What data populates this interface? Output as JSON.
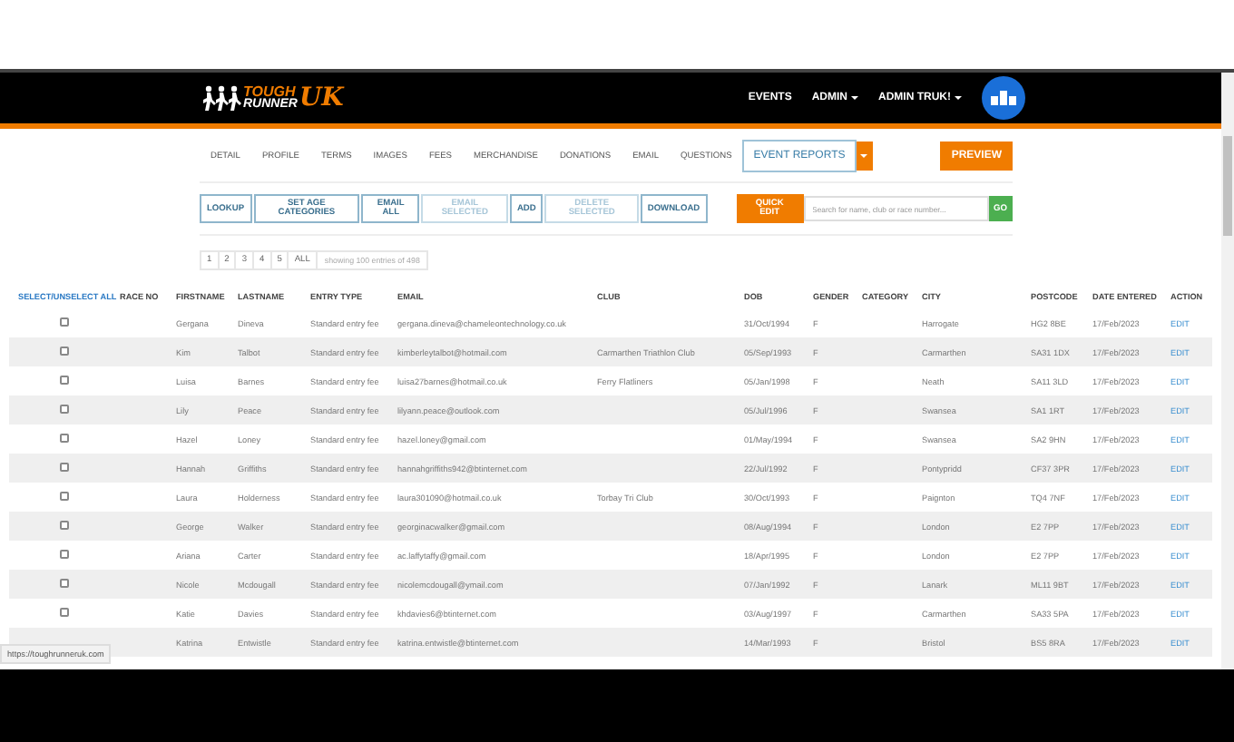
{
  "header": {
    "logo": {
      "tough": "TOUGH",
      "runner": "RUNNER",
      "uk": "UK"
    },
    "nav": [
      {
        "label": "EVENTS",
        "dropdown": false
      },
      {
        "label": "ADMIN",
        "dropdown": true
      },
      {
        "label": "ADMIN TRUK!",
        "dropdown": true
      }
    ]
  },
  "tabs": [
    {
      "label": "DETAIL",
      "selected": false
    },
    {
      "label": "PROFILE",
      "selected": false
    },
    {
      "label": "TERMS",
      "selected": false
    },
    {
      "label": "IMAGES",
      "selected": false
    },
    {
      "label": "FEES",
      "selected": false
    },
    {
      "label": "MERCHANDISE",
      "selected": false
    },
    {
      "label": "DONATIONS",
      "selected": false
    },
    {
      "label": "EMAIL",
      "selected": false
    },
    {
      "label": "QUESTIONS",
      "selected": false
    },
    {
      "label": "EVENT REPORTS",
      "selected": true
    }
  ],
  "preview_button": "PREVIEW",
  "actions": [
    {
      "label": "LOOKUP",
      "disabled": false
    },
    {
      "label": "SET AGE CATEGORIES",
      "disabled": false
    },
    {
      "label": "EMAIL ALL",
      "disabled": false
    },
    {
      "label": "EMAIL SELECTED",
      "disabled": true
    },
    {
      "label": "ADD",
      "disabled": false
    },
    {
      "label": "DELETE SELECTED",
      "disabled": true
    },
    {
      "label": "DOWNLOAD",
      "disabled": false
    }
  ],
  "quick_edit": "QUICK EDIT",
  "search": {
    "placeholder": "Search for name, club or race number...",
    "button": "GO"
  },
  "pagination": {
    "pages": [
      "1",
      "2",
      "3",
      "4",
      "5",
      "ALL"
    ],
    "summary": "showing 100 entries of 498"
  },
  "table": {
    "columns": [
      "SELECT/UNSELECT ALL",
      "RACE NO",
      "FIRSTNAME",
      "LASTNAME",
      "ENTRY TYPE",
      "EMAIL",
      "CLUB",
      "DOB",
      "GENDER",
      "CATEGORY",
      "CITY",
      "POSTCODE",
      "DATE ENTERED",
      "ACTION"
    ],
    "rows": [
      {
        "checked": false,
        "cells": [
          "",
          "",
          "Gergana",
          "Dineva",
          "Standard entry fee",
          "gergana.dineva@chameleontechnology.co.uk",
          "",
          "31/Oct/1994",
          "F",
          "",
          "Harrogate",
          "HG2 8BE",
          "17/Feb/2023",
          "EDIT"
        ]
      },
      {
        "checked": false,
        "cells": [
          "",
          "",
          "Kim",
          "Talbot",
          "Standard entry fee",
          "kimberleytalbot@hotmail.com",
          "Carmarthen Triathlon Club",
          "05/Sep/1993",
          "F",
          "",
          "Carmarthen",
          "SA31 1DX",
          "17/Feb/2023",
          "EDIT"
        ]
      },
      {
        "checked": false,
        "cells": [
          "",
          "",
          "Luisa",
          "Barnes",
          "Standard entry fee",
          "luisa27barnes@hotmail.co.uk",
          "Ferry Flatliners",
          "05/Jan/1998",
          "F",
          "",
          "Neath",
          "SA11 3LD",
          "17/Feb/2023",
          "EDIT"
        ]
      },
      {
        "checked": false,
        "cells": [
          "",
          "",
          "Lily",
          "Peace",
          "Standard entry fee",
          "lilyann.peace@outlook.com",
          "",
          "05/Jul/1996",
          "F",
          "",
          "Swansea",
          "SA1 1RT",
          "17/Feb/2023",
          "EDIT"
        ]
      },
      {
        "checked": false,
        "cells": [
          "",
          "",
          "Hazel",
          "Loney",
          "Standard entry fee",
          "hazel.loney@gmail.com",
          "",
          "01/May/1994",
          "F",
          "",
          "Swansea",
          "SA2 9HN",
          "17/Feb/2023",
          "EDIT"
        ]
      },
      {
        "checked": false,
        "cells": [
          "",
          "",
          "Hannah",
          "Griffiths",
          "Standard entry fee",
          "hannahgriffiths942@btinternet.com",
          "",
          "22/Jul/1992",
          "F",
          "",
          "Pontypridd",
          "CF37 3PR",
          "17/Feb/2023",
          "EDIT"
        ]
      },
      {
        "checked": false,
        "cells": [
          "",
          "",
          "Laura",
          "Holderness",
          "Standard entry fee",
          "laura301090@hotmail.co.uk",
          "Torbay Tri Club",
          "30/Oct/1993",
          "F",
          "",
          "Paignton",
          "TQ4 7NF",
          "17/Feb/2023",
          "EDIT"
        ]
      },
      {
        "checked": false,
        "cells": [
          "",
          "",
          "George",
          "Walker",
          "Standard entry fee",
          "georginacwalker@gmail.com",
          "",
          "08/Aug/1994",
          "F",
          "",
          "London",
          "E2 7PP",
          "17/Feb/2023",
          "EDIT"
        ]
      },
      {
        "checked": false,
        "cells": [
          "",
          "",
          "Ariana",
          "Carter",
          "Standard entry fee",
          "ac.laffytaffy@gmail.com",
          "",
          "18/Apr/1995",
          "F",
          "",
          "London",
          "E2 7PP",
          "17/Feb/2023",
          "EDIT"
        ]
      },
      {
        "checked": false,
        "cells": [
          "",
          "",
          "Nicole",
          "Mcdougall",
          "Standard entry fee",
          "nicolemcdougall@ymail.com",
          "",
          "07/Jan/1992",
          "F",
          "",
          "Lanark",
          "ML11 9BT",
          "17/Feb/2023",
          "EDIT"
        ]
      },
      {
        "checked": false,
        "cells": [
          "",
          "",
          "Katie",
          "Davies",
          "Standard entry fee",
          "khdavies6@btinternet.com",
          "",
          "03/Aug/1997",
          "F",
          "",
          "Carmarthen",
          "SA33 5PA",
          "17/Feb/2023",
          "EDIT"
        ]
      },
      {
        "cells": [
          "",
          "",
          "Katrina",
          "Entwistle",
          "Standard entry fee",
          "katrina.entwistle@btinternet.com",
          "",
          "14/Mar/1993",
          "F",
          "",
          "Bristol",
          "BS5 8RA",
          "17/Feb/2023",
          "EDIT"
        ]
      }
    ]
  },
  "status_url": "https://toughrunneruk.com"
}
